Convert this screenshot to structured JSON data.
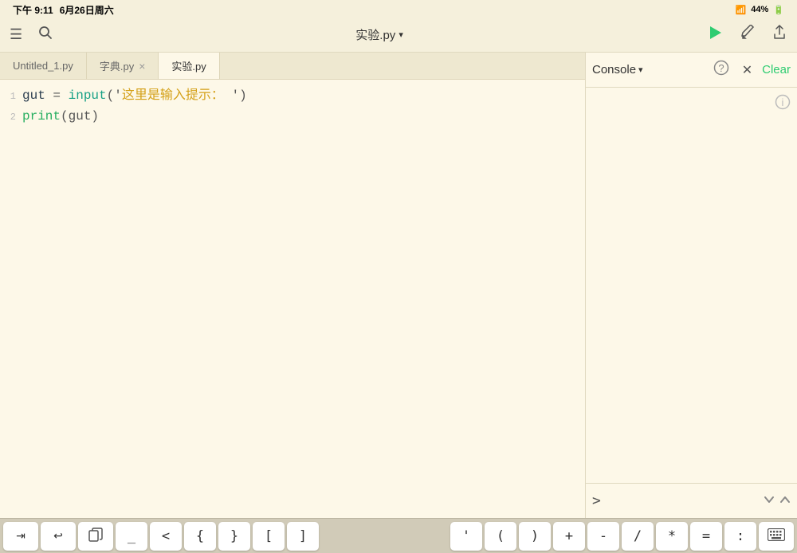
{
  "statusBar": {
    "time": "下午 9:11",
    "date": "6月26日周六",
    "wifi": "WiFi",
    "battery": "44%"
  },
  "toolbar": {
    "menuIcon": "≡",
    "searchIcon": "🔍",
    "filename": "实验.py",
    "chevron": "▾",
    "runIcon": "▶",
    "editIcon": "✏",
    "shareIcon": "↑"
  },
  "tabs": [
    {
      "id": "tab1",
      "label": "Untitled_1.py",
      "active": false,
      "closable": false
    },
    {
      "id": "tab2",
      "label": "字典.py",
      "active": false,
      "closable": true
    },
    {
      "id": "tab3",
      "label": "实验.py",
      "active": true,
      "closable": false
    }
  ],
  "code": {
    "lines": [
      {
        "num": "1",
        "tokens": [
          {
            "text": "gut",
            "color": "var-dark"
          },
          {
            "text": " = ",
            "color": "punc"
          },
          {
            "text": "input",
            "color": "kw-teal"
          },
          {
            "text": "('",
            "color": "punc"
          },
          {
            "text": "这里是输入提示：",
            "color": "str-yellow"
          },
          {
            "text": " ')",
            "color": "punc"
          }
        ]
      },
      {
        "num": "2",
        "tokens": [
          {
            "text": "print",
            "color": "kw-green"
          },
          {
            "text": "(gut)",
            "color": "punc"
          }
        ]
      }
    ]
  },
  "console": {
    "title": "Console",
    "chevron": "▾",
    "clearLabel": "Clear",
    "prompt": ">",
    "inputPlaceholder": ""
  },
  "keyboardToolbar": {
    "buttons": [
      {
        "id": "tab",
        "label": "⇥",
        "type": "icon"
      },
      {
        "id": "undo",
        "label": "↩",
        "type": "icon"
      },
      {
        "id": "copy",
        "label": "⧉",
        "type": "icon"
      },
      {
        "id": "underscore",
        "label": "_",
        "type": "sym"
      },
      {
        "id": "lt",
        "label": "<",
        "type": "sym"
      },
      {
        "id": "lbrace",
        "label": "{",
        "type": "sym"
      },
      {
        "id": "rbrace",
        "label": "}",
        "type": "sym"
      },
      {
        "id": "lbracket",
        "label": "[",
        "type": "sym"
      },
      {
        "id": "rbracket",
        "label": "]",
        "type": "sym"
      },
      {
        "id": "quote",
        "label": "'",
        "type": "sym"
      },
      {
        "id": "lparen",
        "label": "(",
        "type": "sym"
      },
      {
        "id": "rparen",
        "label": ")",
        "type": "sym"
      },
      {
        "id": "plus",
        "label": "+",
        "type": "sym"
      },
      {
        "id": "minus",
        "label": "-",
        "type": "sym"
      },
      {
        "id": "slash",
        "label": "/",
        "type": "sym"
      },
      {
        "id": "star",
        "label": "*",
        "type": "sym"
      },
      {
        "id": "equals",
        "label": "=",
        "type": "sym"
      },
      {
        "id": "colon",
        "label": ":",
        "type": "sym"
      },
      {
        "id": "keyboard",
        "label": "⌨",
        "type": "icon"
      }
    ]
  }
}
